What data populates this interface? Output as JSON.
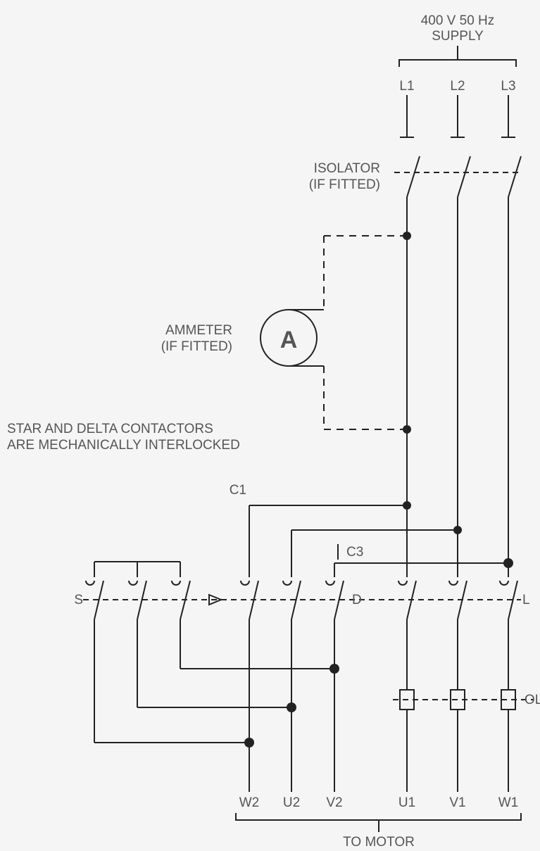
{
  "title": {
    "line1": "400 V 50 Hz",
    "line2": "SUPPLY"
  },
  "phases": {
    "l1": "L1",
    "l2": "L2",
    "l3": "L3"
  },
  "isolator": {
    "line1": "ISOLATOR",
    "line2": "(IF FITTED)"
  },
  "ammeter": {
    "line1": "AMMETER",
    "line2": "(IF FITTED)",
    "symbol": "A"
  },
  "note": {
    "line1": "STAR AND DELTA CONTACTORS",
    "line2": "ARE MECHANICALLY INTERLOCKED"
  },
  "contactors": {
    "s": "S",
    "d": "D",
    "l": "L"
  },
  "taps": {
    "c1": "C1",
    "c3": "C3"
  },
  "ol": "OL",
  "terminals": {
    "w2": "W2",
    "u2": "U2",
    "v2": "V2",
    "u1": "U1",
    "v1": "V1",
    "w1": "W1"
  },
  "footer": "TO MOTOR"
}
